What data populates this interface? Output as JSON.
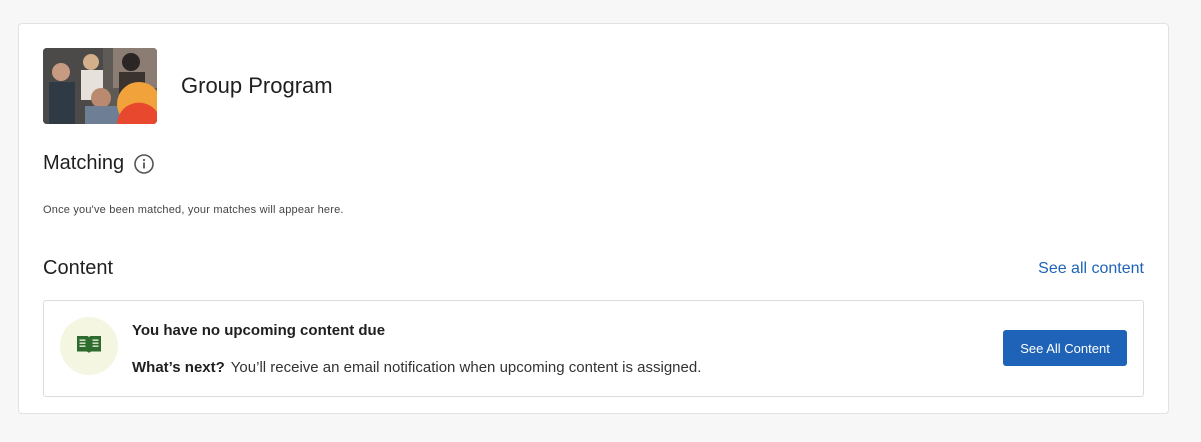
{
  "program": {
    "title": "Group Program",
    "image_icon": "group-photo"
  },
  "matching": {
    "title": "Matching",
    "info_icon": "info-icon",
    "note": "Once you've been matched, your matches will appear here."
  },
  "content": {
    "title": "Content",
    "see_all_link": "See all content",
    "box": {
      "icon": "book-icon",
      "heading": "You have no upcoming content due",
      "next_label": "What’s next?",
      "next_text": "You’ll receive an email notification when upcoming content is assigned.",
      "button_label": "See All Content"
    }
  },
  "colors": {
    "accent": "#1f63b8",
    "book_icon": "#2e6b2e",
    "book_circle_bg": "#f4f6e2"
  }
}
